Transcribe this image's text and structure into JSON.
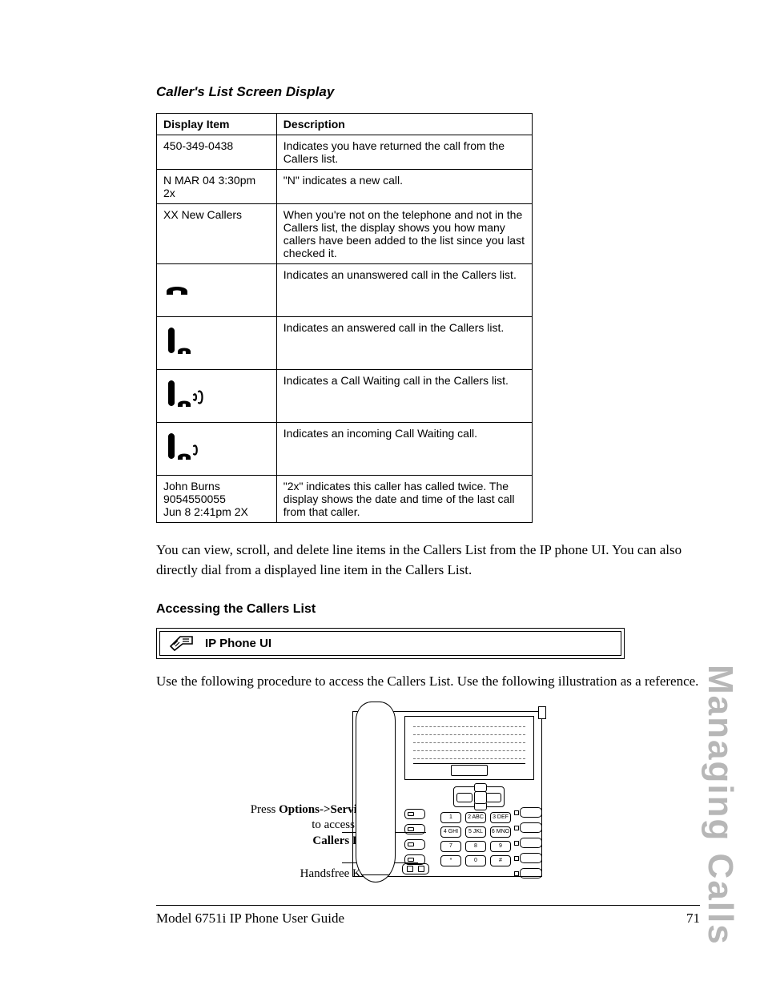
{
  "section_title": "Caller's List Screen Display",
  "table": {
    "headers": [
      "Display Item",
      "Description"
    ],
    "rows": [
      {
        "item": "450-349-0438",
        "desc": "Indicates you have returned the call from the Callers list."
      },
      {
        "item": "N MAR 04 3:30pm 2x",
        "desc": "\"N\" indicates a new call."
      },
      {
        "item": "XX New Callers",
        "desc": "When you're not on the telephone and not in the Callers list, the display shows you how many callers have been added to the list since you last checked it."
      },
      {
        "icon": "handset-on-hook-icon",
        "desc": "Indicates an unanswered call in the Callers list."
      },
      {
        "icon": "handset-off-hook-icon",
        "desc": "Indicates an answered call in the Callers list."
      },
      {
        "icon": "call-waiting-double-icon",
        "desc": "Indicates a Call Waiting call in the Callers list."
      },
      {
        "icon": "call-waiting-single-icon",
        "desc": "Indicates an incoming Call Waiting call."
      },
      {
        "item": "John Burns\n9054550055\nJun 8 2:41pm  2X",
        "desc": "\"2x\" indicates this caller has called twice. The display shows the date and time of the last call from that caller."
      }
    ]
  },
  "body_text": "You can view, scroll, and delete line items in the Callers List from the IP phone UI. You can also directly dial from a displayed line item in the Callers List.",
  "sub_heading": "Accessing the Callers List",
  "ui_box_label": "IP Phone UI",
  "procedure_text": "Use the following procedure to access the Callers List. Use the following illustration as a reference.",
  "illustration": {
    "label_options_line1": "Press ",
    "label_options_bold": "Options->Services",
    "label_options_line2": "to access the",
    "label_options_line3": "Callers List",
    "label_handsfree": "Handsfree Key",
    "keypad": [
      "1",
      "2 ABC",
      "3 DEF",
      "4 GHI",
      "5 JKL",
      "6 MNO",
      "7",
      "8",
      "9",
      "*",
      "0",
      "#"
    ]
  },
  "sidebar": "Managing Calls",
  "footer_left": "Model 6751i IP Phone User Guide",
  "footer_right": "71"
}
